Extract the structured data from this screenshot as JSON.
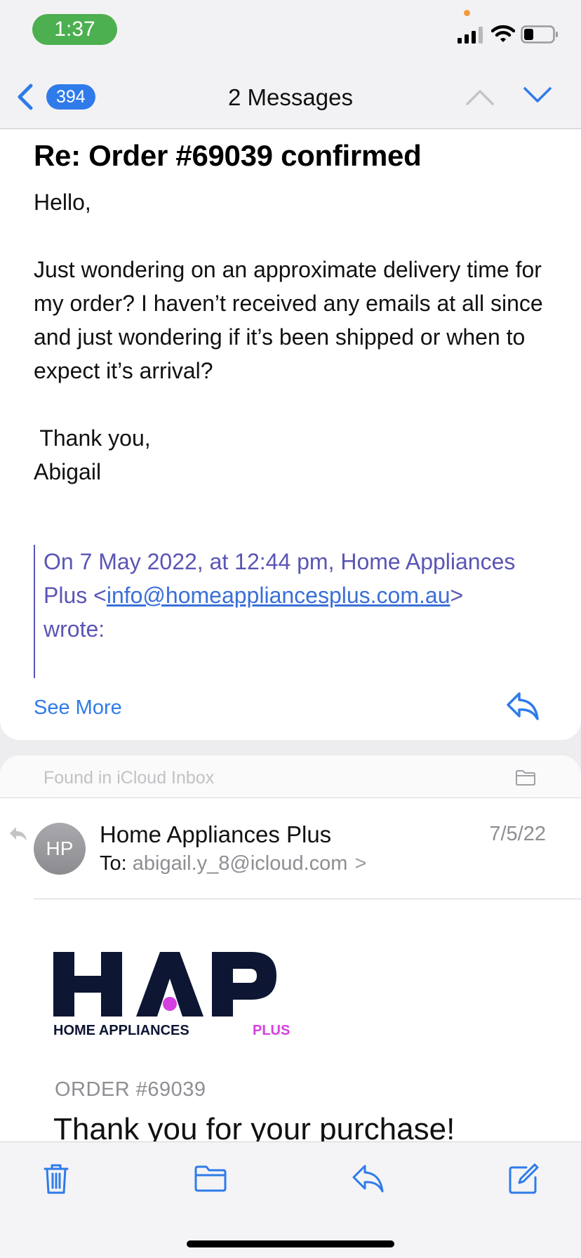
{
  "status_bar": {
    "time": "1:37",
    "icons": [
      "signal-icon",
      "wifi-icon",
      "battery-icon"
    ]
  },
  "nav": {
    "unread_count": "394",
    "title": "2 Messages",
    "icons": [
      "back-chevron-icon",
      "chevron-up-icon",
      "chevron-down-icon"
    ]
  },
  "message": {
    "subject": "Re: Order #69039 confirmed",
    "greeting": "Hello,",
    "paragraph": "Just wondering on an approximate delivery time for my order? I haven’t received any emails at all since and just wondering if it’s been shipped or when to expect it’s arrival?",
    "signoff": " Thank you,",
    "signature": "Abigail",
    "quote_prefix": "On 7 May 2022, at 12:44 pm, Home Appliances Plus <",
    "quote_email": "info@homeappliancesplus.com.au",
    "quote_suffix": ">",
    "quote_wrote": "wrote:",
    "see_more": "See More"
  },
  "thread": {
    "found_in": "Found in iCloud Inbox",
    "avatar_initials": "HP",
    "sender": "Home Appliances Plus",
    "date": "7/5/22",
    "to_label": "To:",
    "to_address": "abigail.y_8@icloud.com",
    "to_chevron": ">",
    "logo_text": "HAP",
    "logo_tagline": "HOME APPLIANCES",
    "logo_tagline_accent": "PLUS",
    "order_label": "ORDER #69039",
    "heading": "Thank you for your purchase!"
  },
  "colors": {
    "accent": "#2f7bea",
    "quote": "#5a55b5",
    "logo_navy": "#0d1633",
    "logo_pink": "#d63fe0",
    "time_pill": "#4caf50"
  },
  "toolbar": {
    "icons": [
      "trash-icon",
      "folder-icon",
      "reply-icon",
      "compose-icon"
    ]
  }
}
